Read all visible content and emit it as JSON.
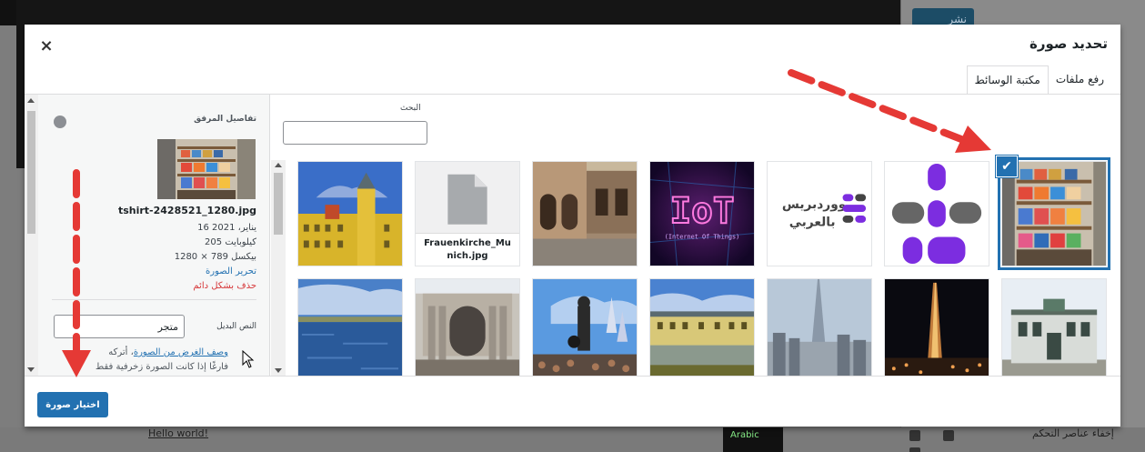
{
  "background": {
    "publish_label": "نشر",
    "hello_link": "Hello world!",
    "language_badge": "Arabic",
    "hide_controls": "إخفاء عناصر التحكم"
  },
  "modal": {
    "title": "تحديد صورة",
    "close_glyph": "×",
    "tabs": [
      {
        "label": "رفع ملفات",
        "active": false
      },
      {
        "label": "مكتبة الوسائط",
        "active": true
      }
    ]
  },
  "search": {
    "label": "البحث",
    "value": ""
  },
  "media_grid": [
    {
      "name": "tshirt-2428521_1280.jpg",
      "kind": "tshirt",
      "selected": true
    },
    {
      "name": "",
      "kind": "logo-dots"
    },
    {
      "name": "",
      "kind": "wp-arabic-logo",
      "text": "ووردبريس بالعربي"
    },
    {
      "name": "",
      "kind": "iot",
      "text": "IoT",
      "subtext": "(Internet Of Things)"
    },
    {
      "name": "",
      "kind": "street"
    },
    {
      "name": "Frauenkirche_Munich.jpg",
      "kind": "document",
      "label_line1": "Frauenkirche_Mu",
      "label_line2": "nich.jpg"
    },
    {
      "name": "",
      "kind": "yellow-palace"
    },
    {
      "name": "",
      "kind": "building"
    },
    {
      "name": "",
      "kind": "night-tower"
    },
    {
      "name": "",
      "kind": "burj"
    },
    {
      "name": "",
      "kind": "palace-water"
    },
    {
      "name": "",
      "kind": "disney"
    },
    {
      "name": "",
      "kind": "ruins"
    },
    {
      "name": "",
      "kind": "sea"
    }
  ],
  "attachment_details": {
    "heading": "تفاصيل المرفق",
    "filename": "tshirt-2428521_1280.jpg",
    "date": "16 يناير، 2021",
    "size": "205 كيلوبايت",
    "dimensions": "1280 × 789 بيكسل",
    "edit_link": "تحرير الصورة",
    "delete_link": "حذف بشكل دائم",
    "alt_label": "النص البديل",
    "alt_value": "متجر",
    "help_link": "وصف الغرض من الصورة",
    "help_text_1": "، أتركه",
    "help_text_2": "فارغًا إذا كانت الصورة زخرفية فقط"
  },
  "footer": {
    "select_button": "اختيار صورة"
  },
  "colors": {
    "accent": "#2271b1",
    "danger": "#d63638",
    "annotation": "#e53935"
  }
}
